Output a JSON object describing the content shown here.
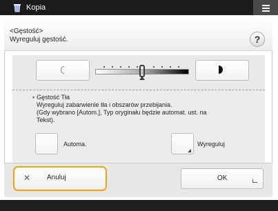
{
  "header": {
    "app_title": "Kopia",
    "icon": "copy-icon"
  },
  "dialog": {
    "title_line1": "<Gęstość>",
    "title_line2": "Wyreguluj gęstość.",
    "help_label": "?"
  },
  "density": {
    "level": 0.5,
    "lighter_icon": "half-circle-outline-icon",
    "darker_icon": "half-circle-filled-icon"
  },
  "background": {
    "title": "Gęstość Tła",
    "description": "Wyreguluj zabarwienie tła i obszarów przebijania.\n(Gdy wybrano [Autom.], Typ oryginału będzie automat. ust. na Tekst).",
    "auto_label": "Automa.",
    "adjust_label": "Wyreguluj"
  },
  "footer": {
    "cancel_label": "Anuluj",
    "ok_label": "OK"
  },
  "colors": {
    "accent": "#f0a30a",
    "header_bg": "#1b1b1b"
  }
}
